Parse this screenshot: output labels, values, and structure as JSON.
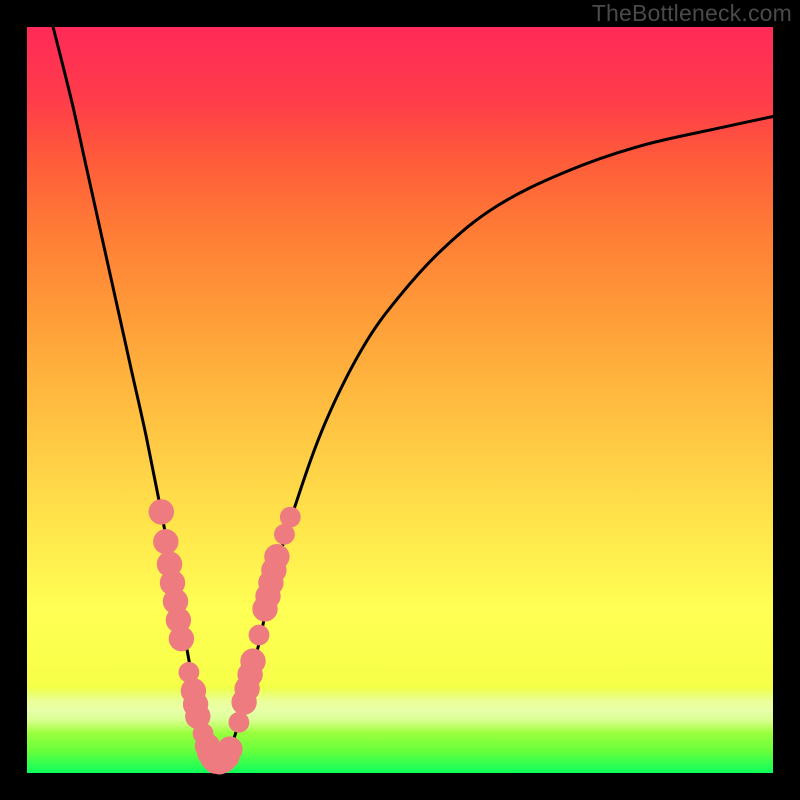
{
  "watermark": "TheBottleneck.com",
  "colors": {
    "marker": "#ee7b80",
    "curve": "#000000",
    "background_black": "#000000"
  },
  "chart_data": {
    "type": "line",
    "title": "",
    "xlabel": "",
    "ylabel": "",
    "xlim": [
      0,
      100
    ],
    "ylim": [
      0,
      100
    ],
    "grid": false,
    "legend": false,
    "note": "V-shaped bottleneck curve with overlaid red markers near the curve minimum. Values estimated from pixel positions; no axis ticks or numeric labels are present in the image.",
    "series": [
      {
        "name": "bottleneck-curve",
        "x": [
          3.5,
          6,
          8,
          10,
          12,
          14,
          16,
          18,
          19.5,
          21,
          22.5,
          24,
          25,
          26,
          27.5,
          29,
          31,
          33,
          36,
          40,
          45,
          50,
          56,
          63,
          72,
          82,
          93,
          100
        ],
        "y": [
          100,
          90,
          81,
          72,
          63,
          54,
          45,
          35,
          27,
          19,
          11,
          5,
          1.5,
          1.5,
          4,
          9,
          17,
          26,
          36,
          47,
          57,
          64,
          70.5,
          76,
          80.5,
          84,
          86.5,
          88
        ]
      }
    ],
    "markers": {
      "note": "Soft red dots / pill clusters along both sides of the V near the bottom.",
      "points": [
        {
          "x": 18.0,
          "y": 35,
          "r": 1.7
        },
        {
          "x": 18.6,
          "y": 31,
          "r": 1.7
        },
        {
          "x": 19.1,
          "y": 28,
          "r": 1.7
        },
        {
          "x": 19.5,
          "y": 25.5,
          "r": 1.7
        },
        {
          "x": 19.9,
          "y": 23,
          "r": 1.7
        },
        {
          "x": 20.3,
          "y": 20.5,
          "r": 1.7
        },
        {
          "x": 20.7,
          "y": 18,
          "r": 1.7
        },
        {
          "x": 21.7,
          "y": 13.5,
          "r": 1.4
        },
        {
          "x": 22.3,
          "y": 11,
          "r": 1.7
        },
        {
          "x": 22.6,
          "y": 9.2,
          "r": 1.7
        },
        {
          "x": 22.9,
          "y": 7.6,
          "r": 1.7
        },
        {
          "x": 23.6,
          "y": 5.3,
          "r": 1.4
        },
        {
          "x": 24.2,
          "y": 3.6,
          "r": 1.7
        },
        {
          "x": 24.5,
          "y": 2.7,
          "r": 1.7
        },
        {
          "x": 24.9,
          "y": 2.0,
          "r": 1.7
        },
        {
          "x": 25.3,
          "y": 1.6,
          "r": 1.7
        },
        {
          "x": 25.8,
          "y": 1.5,
          "r": 1.7
        },
        {
          "x": 26.3,
          "y": 1.7,
          "r": 1.7
        },
        {
          "x": 26.8,
          "y": 2.2,
          "r": 1.7
        },
        {
          "x": 27.2,
          "y": 3.2,
          "r": 1.7
        },
        {
          "x": 28.4,
          "y": 6.8,
          "r": 1.4
        },
        {
          "x": 29.1,
          "y": 9.5,
          "r": 1.7
        },
        {
          "x": 29.5,
          "y": 11.3,
          "r": 1.7
        },
        {
          "x": 29.9,
          "y": 13.2,
          "r": 1.7
        },
        {
          "x": 30.3,
          "y": 15.0,
          "r": 1.7
        },
        {
          "x": 31.1,
          "y": 18.5,
          "r": 1.4
        },
        {
          "x": 31.9,
          "y": 22,
          "r": 1.7
        },
        {
          "x": 32.3,
          "y": 23.7,
          "r": 1.7
        },
        {
          "x": 32.7,
          "y": 25.5,
          "r": 1.7
        },
        {
          "x": 33.1,
          "y": 27.2,
          "r": 1.7
        },
        {
          "x": 33.5,
          "y": 29,
          "r": 1.7
        },
        {
          "x": 34.5,
          "y": 32,
          "r": 1.4
        },
        {
          "x": 35.3,
          "y": 34.3,
          "r": 1.4
        }
      ]
    }
  }
}
